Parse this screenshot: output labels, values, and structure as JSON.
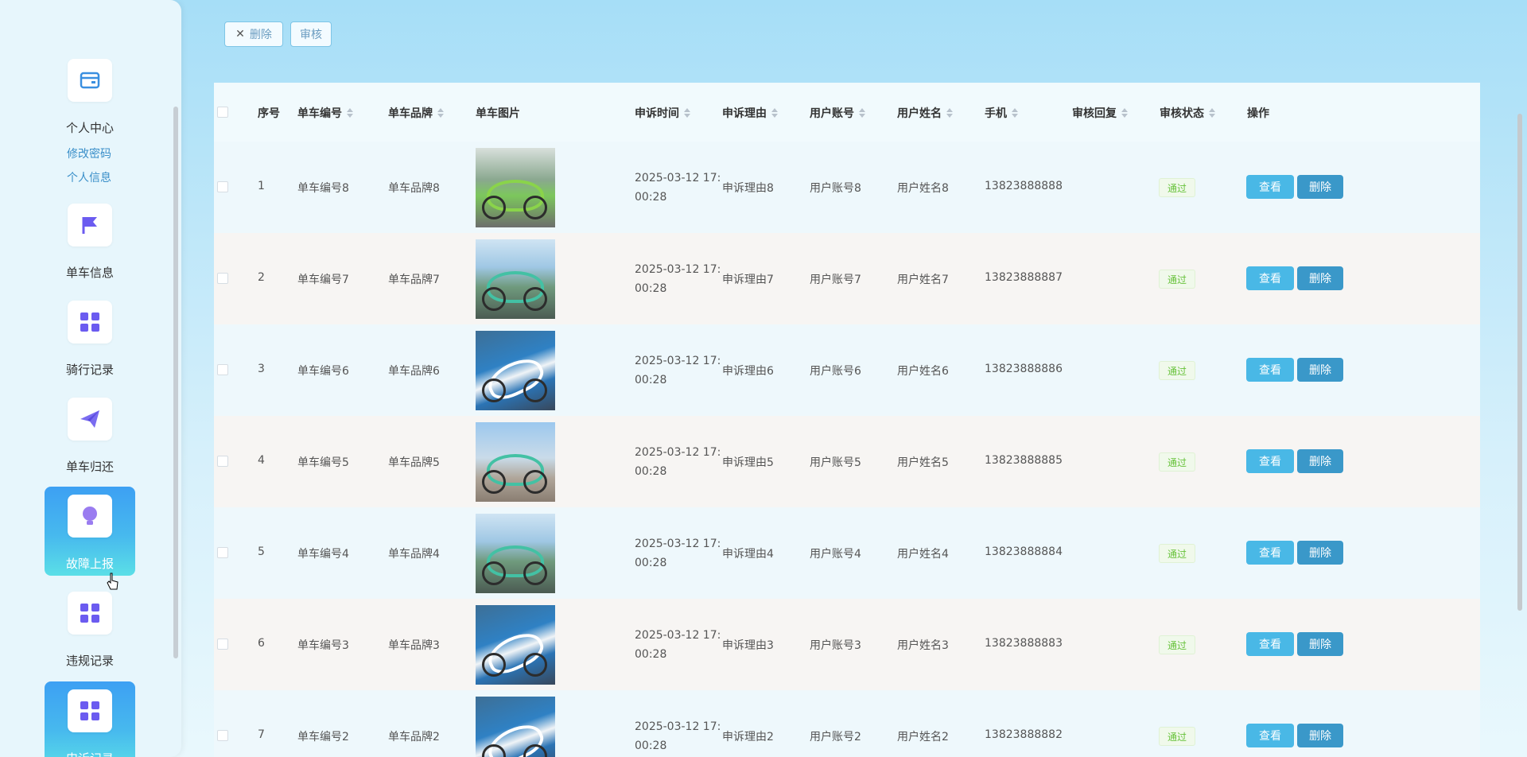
{
  "sidebar": {
    "menu": [
      {
        "label": "个人中心",
        "icon": "wallet-icon"
      },
      {
        "label": "单车信息",
        "icon": "flag-icon"
      },
      {
        "label": "骑行记录",
        "icon": "grid-icon"
      },
      {
        "label": "单车归还",
        "icon": "send-icon"
      },
      {
        "label": "故障上报",
        "icon": "bulb-icon"
      },
      {
        "label": "违规记录",
        "icon": "grid-icon"
      },
      {
        "label": "申诉记录",
        "icon": "grid-icon"
      }
    ],
    "sub_links": [
      "修改密码",
      "个人信息"
    ],
    "active_item": "故障上报"
  },
  "toolbar": {
    "delete_label": "删除",
    "audit_label": "审核"
  },
  "table": {
    "headers": {
      "index": "序号",
      "bike_no": "单车编号",
      "brand": "单车品牌",
      "image": "单车图片",
      "time": "申诉时间",
      "reason": "申诉理由",
      "account": "用户账号",
      "name": "用户姓名",
      "phone": "手机",
      "reply": "审核回复",
      "status": "审核状态",
      "ops": "操作"
    },
    "view_label": "查看",
    "delete_label": "删除",
    "rows": [
      {
        "index": "1",
        "bike_no": "单车编号8",
        "brand": "单车品牌8",
        "time1": "2025-03-12 17:",
        "time2": "00:28",
        "reason": "申诉理由8",
        "account": "用户账号8",
        "name": "用户姓名8",
        "phone": "13823888888",
        "status": "通过"
      },
      {
        "index": "2",
        "bike_no": "单车编号7",
        "brand": "单车品牌7",
        "time1": "2025-03-12 17:",
        "time2": "00:28",
        "reason": "申诉理由7",
        "account": "用户账号7",
        "name": "用户姓名7",
        "phone": "13823888887",
        "status": "通过"
      },
      {
        "index": "3",
        "bike_no": "单车编号6",
        "brand": "单车品牌6",
        "time1": "2025-03-12 17:",
        "time2": "00:28",
        "reason": "申诉理由6",
        "account": "用户账号6",
        "name": "用户姓名6",
        "phone": "13823888886",
        "status": "通过"
      },
      {
        "index": "4",
        "bike_no": "单车编号5",
        "brand": "单车品牌5",
        "time1": "2025-03-12 17:",
        "time2": "00:28",
        "reason": "申诉理由5",
        "account": "用户账号5",
        "name": "用户姓名5",
        "phone": "13823888885",
        "status": "通过"
      },
      {
        "index": "5",
        "bike_no": "单车编号4",
        "brand": "单车品牌4",
        "time1": "2025-03-12 17:",
        "time2": "00:28",
        "reason": "申诉理由4",
        "account": "用户账号4",
        "name": "用户姓名4",
        "phone": "13823888884",
        "status": "通过"
      },
      {
        "index": "6",
        "bike_no": "单车编号3",
        "brand": "单车品牌3",
        "time1": "2025-03-12 17:",
        "time2": "00:28",
        "reason": "申诉理由3",
        "account": "用户账号3",
        "name": "用户姓名3",
        "phone": "13823888883",
        "status": "通过"
      },
      {
        "index": "7",
        "bike_no": "单车编号2",
        "brand": "单车品牌2",
        "time1": "2025-03-12 17:",
        "time2": "00:28",
        "reason": "申诉理由2",
        "account": "用户账号2",
        "name": "用户姓名2",
        "phone": "13823888882",
        "status": "通过"
      }
    ]
  },
  "colors": {
    "accent": "#49b8e6",
    "active_menu": "#3da0f3",
    "status_pass": "#67c23a"
  }
}
